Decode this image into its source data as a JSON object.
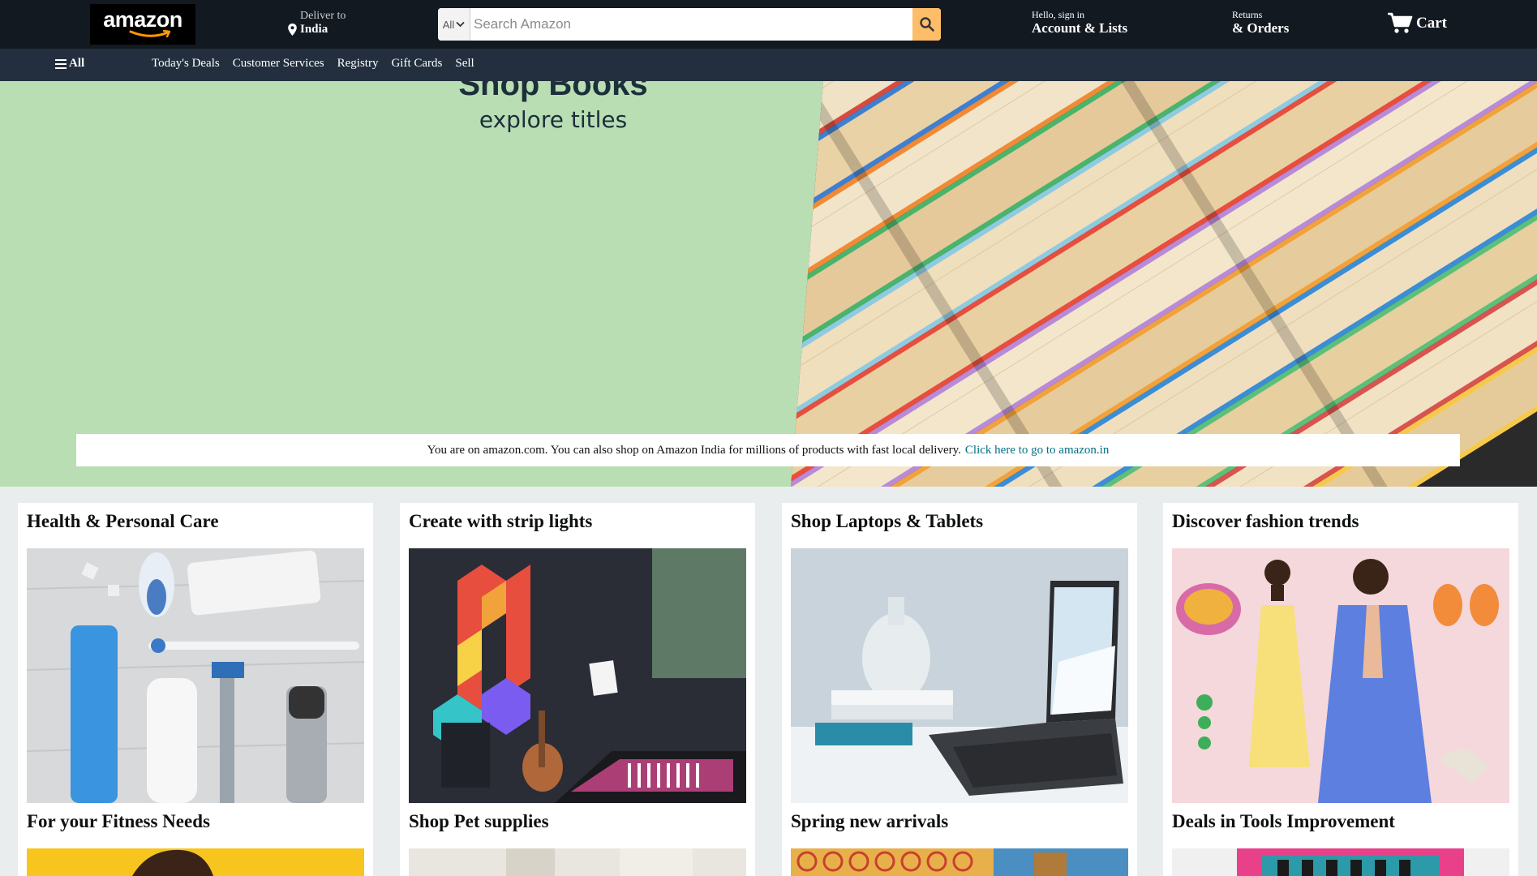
{
  "header": {
    "logo_text": "amazon",
    "deliver_to_label": "Deliver to",
    "deliver_to_location": "India",
    "search_category": "All",
    "search_placeholder": "Search Amazon",
    "account_greeting": "Hello, sign in",
    "account_label": "Account & Lists",
    "returns_label": "Returns",
    "orders_label": "& Orders",
    "cart_label": "Cart"
  },
  "subnav": {
    "all_label": "All",
    "links": [
      "Today's Deals",
      "Customer Services",
      "Registry",
      "Gift Cards",
      "Sell"
    ]
  },
  "hero": {
    "title": "Shop Books",
    "subtitle": "explore titles",
    "notice_text": "You are on amazon.com. You can also shop on Amazon India for millions of products with fast local delivery.",
    "notice_link": "Click here to go to amazon.in"
  },
  "cards": [
    {
      "title": "Health & Personal Care",
      "image": "health-personal-care-products"
    },
    {
      "title": "Create with strip lights",
      "image": "music-note-light-panels"
    },
    {
      "title": "Shop Laptops & Tablets",
      "image": "laptop-on-desk"
    },
    {
      "title": "Discover fashion trends",
      "image": "fashion-models"
    },
    {
      "title": "For your Fitness Needs",
      "image": "fitness"
    },
    {
      "title": "Shop Pet supplies",
      "image": "pet-supplies"
    },
    {
      "title": "Spring new arrivals",
      "image": "welcome-sign"
    },
    {
      "title": "Deals in Tools Improvement",
      "image": "tools"
    }
  ],
  "colors": {
    "nav_top": "#131921",
    "nav_sub": "#232f3e",
    "search_button": "#febd69",
    "hero_bg": "#b9deb4",
    "link": "#007185",
    "page_bg": "#eaeded"
  }
}
